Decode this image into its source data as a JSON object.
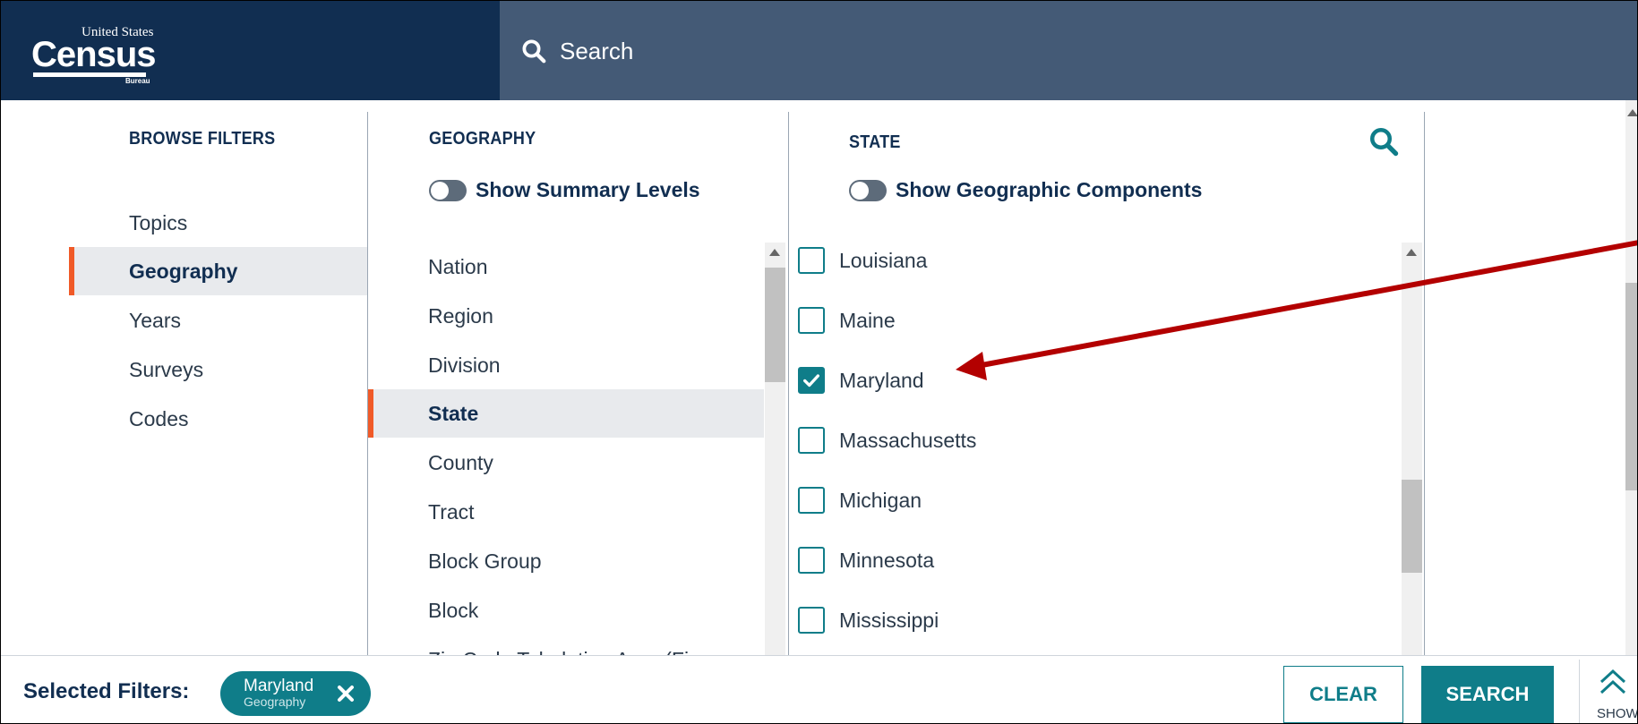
{
  "header": {
    "logo": {
      "line1": "United States",
      "line2": "Census",
      "line3": "Bureau"
    },
    "search_label": "Search"
  },
  "browse": {
    "heading": "BROWSE FILTERS",
    "items": [
      {
        "label": "Topics",
        "active": false
      },
      {
        "label": "Geography",
        "active": true
      },
      {
        "label": "Years",
        "active": false
      },
      {
        "label": "Surveys",
        "active": false
      },
      {
        "label": "Codes",
        "active": false
      }
    ]
  },
  "geography": {
    "heading": "GEOGRAPHY",
    "toggle_label": "Show Summary Levels",
    "items": [
      {
        "label": "Nation"
      },
      {
        "label": "Region"
      },
      {
        "label": "Division"
      },
      {
        "label": "State",
        "active": true
      },
      {
        "label": "County"
      },
      {
        "label": "Tract"
      },
      {
        "label": "Block Group"
      },
      {
        "label": "Block"
      },
      {
        "label": "Zip Code Tabulation Area (Fi"
      }
    ]
  },
  "state": {
    "heading": "STATE",
    "toggle_label": "Show Geographic Components",
    "items": [
      {
        "label": "Louisiana",
        "checked": false
      },
      {
        "label": "Maine",
        "checked": false
      },
      {
        "label": "Maryland",
        "checked": true
      },
      {
        "label": "Massachusetts",
        "checked": false
      },
      {
        "label": "Michigan",
        "checked": false
      },
      {
        "label": "Minnesota",
        "checked": false
      },
      {
        "label": "Mississippi",
        "checked": false
      }
    ]
  },
  "footer": {
    "selected_label": "Selected Filters:",
    "chip": {
      "title": "Maryland",
      "subtitle": "Geography"
    },
    "clear_label": "CLEAR",
    "search_label": "SEARCH",
    "show_label": "SHOW"
  },
  "colors": {
    "navy": "#112e51",
    "slate": "#445a76",
    "teal": "#0f7d89",
    "accent": "#f05a28",
    "arrow": "#b30000"
  },
  "icons": [
    "search-icon",
    "chevron-double-up-icon",
    "checkmark-icon",
    "close-icon"
  ]
}
